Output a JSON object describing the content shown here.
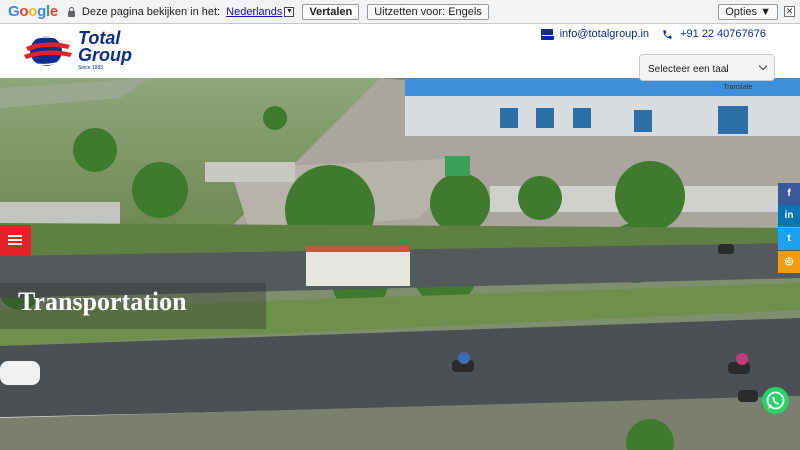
{
  "translate_bar": {
    "prompt": "Deze pagina bekijken in het:",
    "language": "Nederlands",
    "translate_button": "Vertalen",
    "turn_off_button": "Uitzetten voor: Engels",
    "options_button": "Opties ▼",
    "close": "✕"
  },
  "header": {
    "logo_line1": "Total",
    "logo_line2": "Group",
    "logo_since": "Since 1983",
    "email": "info@totalgroup.in",
    "phone": "+91 22 40767676"
  },
  "language_select": {
    "value": "Selecteer een taal",
    "powered_by": "Translate"
  },
  "hero": {
    "title": "Transportation"
  },
  "social": [
    {
      "name": "facebook",
      "glyph": "f",
      "color": "#3b5998"
    },
    {
      "name": "linkedin",
      "glyph": "in",
      "color": "#0077b5"
    },
    {
      "name": "twitter",
      "glyph": "t",
      "color": "#1da1f2"
    },
    {
      "name": "instagram",
      "glyph": "◎",
      "color": "#f39c12"
    }
  ],
  "colors": {
    "brand": "#0a2d8f",
    "menu": "#e32227",
    "whatsapp": "#25d366"
  }
}
